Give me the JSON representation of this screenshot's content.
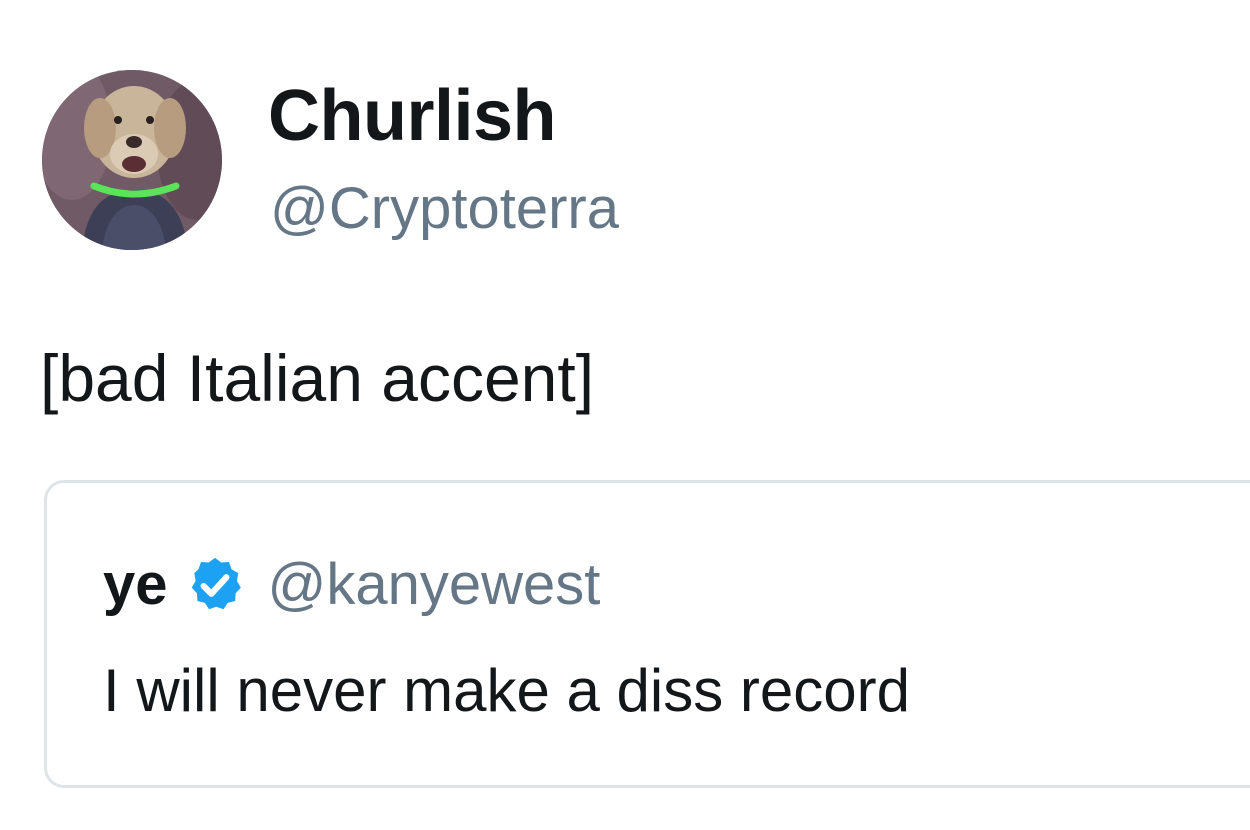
{
  "tweet": {
    "author": {
      "name": "Churlish",
      "handle": "@Cryptoterra",
      "avatar_icon": "dog-avatar-icon"
    },
    "text": "[bad Italian accent]",
    "quoted_tweet": {
      "author": {
        "name": "ye",
        "handle": "@kanyewest",
        "verified": true,
        "verified_icon": "verified-badge-icon"
      },
      "text": "I will never make a diss record"
    }
  },
  "colors": {
    "text_primary": "#14171a",
    "text_secondary": "#657786",
    "verified_blue": "#1da1f2",
    "card_border": "#dfe4e8",
    "collar_green": "#5be35a"
  }
}
